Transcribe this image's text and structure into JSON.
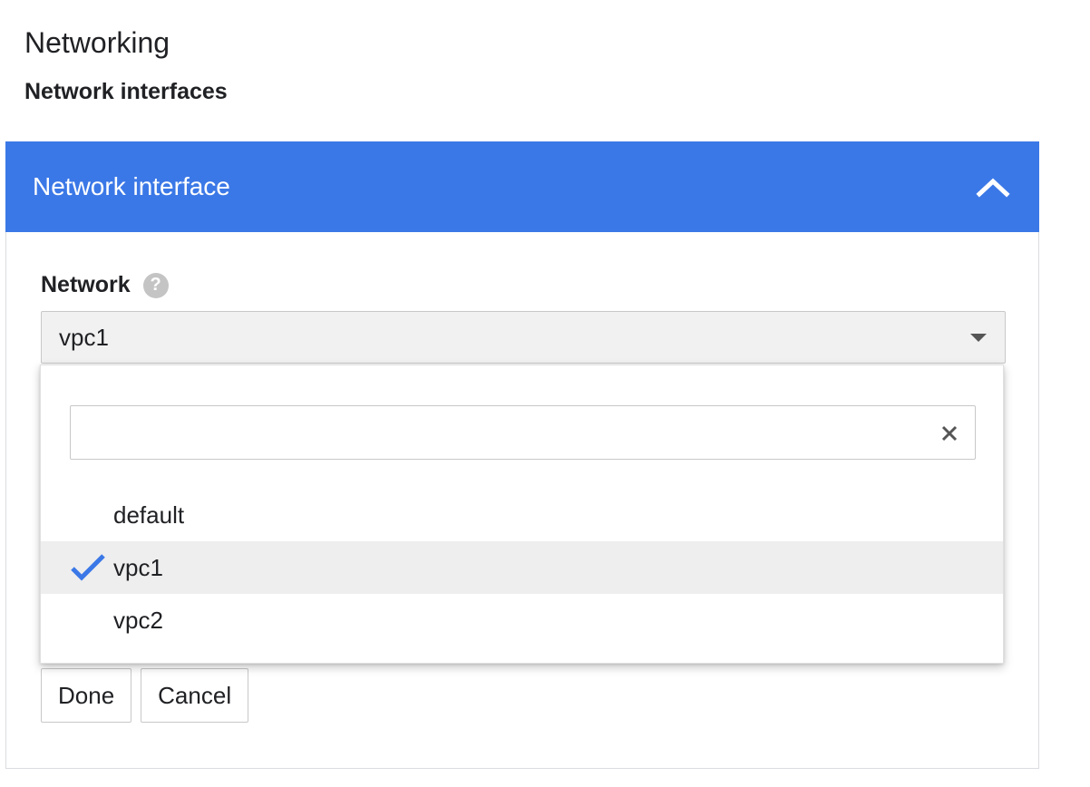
{
  "page": {
    "title": "Networking",
    "section_title": "Network interfaces"
  },
  "panel": {
    "header_title": "Network interface",
    "collapse_icon": "chevron-up-icon",
    "header_color": "#3b78e7"
  },
  "network_field": {
    "label": "Network",
    "help_icon": "help-icon",
    "help_glyph": "?",
    "selected_value": "vpc1"
  },
  "dropdown_menu": {
    "search_placeholder": "",
    "search_value": "",
    "clear_icon": "clear-icon",
    "options": [
      {
        "label": "default",
        "selected": false
      },
      {
        "label": "vpc1",
        "selected": true
      },
      {
        "label": "vpc2",
        "selected": false
      }
    ],
    "check_color": "#3b78e7"
  },
  "actions": {
    "done_label": "Done",
    "cancel_label": "Cancel"
  }
}
